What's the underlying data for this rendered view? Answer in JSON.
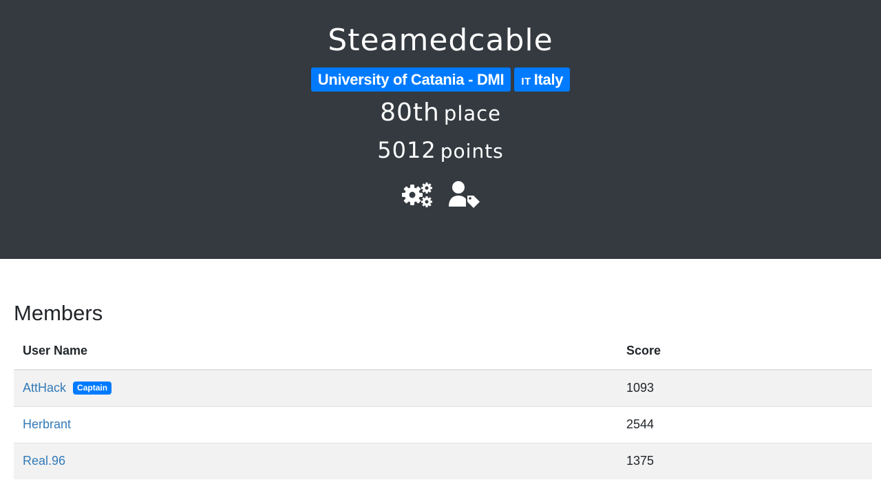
{
  "team": {
    "name": "Steamedcable",
    "affiliation": "University of Catania - DMI",
    "country_code": "IT",
    "country": "Italy",
    "place_number": "80th",
    "place_word": "place",
    "points_number": "5012",
    "points_word": "points",
    "icons": [
      "gears-icon",
      "user-tag-icon"
    ]
  },
  "members": {
    "title": "Members",
    "columns": [
      "User Name",
      "Score"
    ],
    "rows": [
      {
        "name": "AttHack",
        "badge": "Captain",
        "score": "1093"
      },
      {
        "name": "Herbrant",
        "badge": "",
        "score": "2544"
      },
      {
        "name": "Real.96",
        "badge": "",
        "score": "1375"
      }
    ]
  },
  "colors": {
    "header_bg": "#343a40",
    "badge_blue": "#007bff",
    "link_blue": "#337ab7",
    "row_stripe": "#f2f2f2"
  }
}
